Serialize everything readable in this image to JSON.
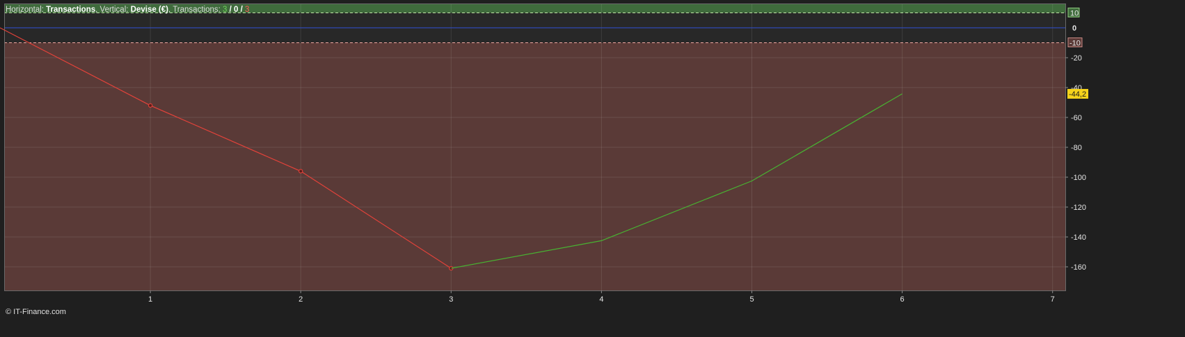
{
  "header": {
    "horizontal_label": "Horizontal:",
    "horizontal_value": "Transactions",
    "sep1": ",",
    "vertical_label": "Vertical:",
    "vertical_value": "Devise (€)",
    "sep2": ",",
    "transactions_label": "Transactions:",
    "count_winning": "3",
    "slash1": "/",
    "count_neutral": "0",
    "slash2": "/",
    "count_losing": "3"
  },
  "credit": "© IT-Finance.com",
  "colors": {
    "background": "#1f1f1f",
    "plot_bg": "#282828",
    "profit_zone": "#3f6b3c",
    "loss_zone": "#5a3a37",
    "zero_line": "#2f4fd6",
    "losing_line": "#e2423a",
    "winning_line": "#48b232",
    "last_value_badge": "#f5d31b",
    "profit_badge": "#3f6b3c",
    "loss_badge": "#5a3a37"
  },
  "chart_data": {
    "type": "line",
    "xlabel": "Transactions",
    "ylabel": "Devise (€)",
    "xlim": [
      0,
      7.7
    ],
    "ylim": [
      -174,
      16
    ],
    "x_ticks": [
      "1",
      "2",
      "3",
      "4",
      "5",
      "6",
      "7"
    ],
    "y_ticks": [
      "-20",
      "-40",
      "-60",
      "-80",
      "-100",
      "-120",
      "-140",
      "-160"
    ],
    "zero_tick": "0",
    "profit_threshold": 10,
    "profit_threshold_label": "10",
    "loss_threshold": -10,
    "loss_threshold_label": "-10",
    "last_value": -44.2,
    "last_value_label": "-44,2",
    "series": [
      {
        "role": "losing",
        "x": [
          0,
          1,
          2,
          3
        ],
        "y": [
          0,
          -52,
          -96,
          -161
        ],
        "markers": [
          1,
          2,
          3
        ]
      },
      {
        "role": "winning",
        "x": [
          3,
          4,
          5,
          6
        ],
        "y": [
          -161,
          -142.5,
          -102.5,
          -44.2
        ]
      }
    ],
    "grid": true,
    "legend": "none"
  }
}
